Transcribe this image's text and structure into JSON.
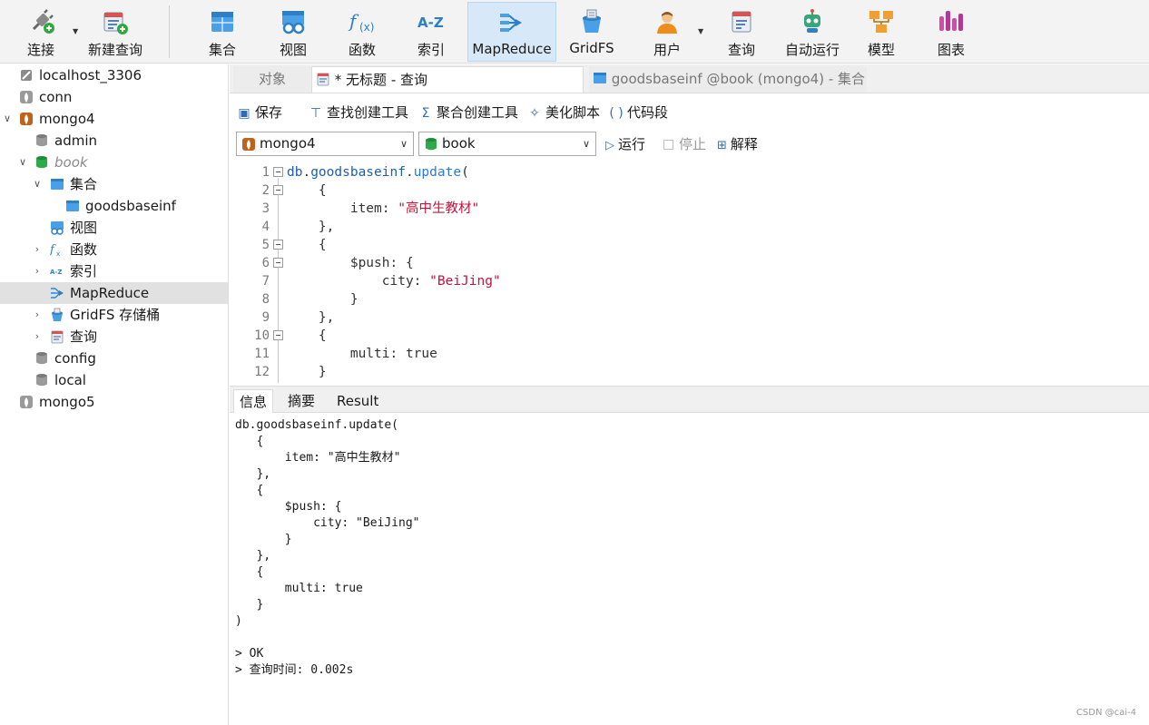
{
  "toolbar": {
    "connect": "连接",
    "new_query": "新建查询",
    "collection": "集合",
    "view": "视图",
    "function": "函数",
    "index": "索引",
    "mapreduce": "MapReduce",
    "gridfs": "GridFS",
    "user": "用户",
    "query": "查询",
    "auto_run": "自动运行",
    "model": "模型",
    "chart": "图表"
  },
  "sidebar": {
    "items": [
      {
        "label": "localhost_3306"
      },
      {
        "label": "conn"
      },
      {
        "label": "mongo4"
      },
      {
        "label": "admin"
      },
      {
        "label": "book"
      },
      {
        "label": "集合"
      },
      {
        "label": "goodsbaseinf"
      },
      {
        "label": "视图"
      },
      {
        "label": "函数"
      },
      {
        "label": "索引"
      },
      {
        "label": "MapReduce"
      },
      {
        "label": "GridFS 存储桶"
      },
      {
        "label": "查询"
      },
      {
        "label": "config"
      },
      {
        "label": "local"
      },
      {
        "label": "mongo5"
      }
    ]
  },
  "tabs": {
    "objects": "对象",
    "untitled": "* 无标题 - 查询",
    "collection_tab": "goodsbaseinf @book (mongo4) - 集合"
  },
  "editor_toolbar": {
    "save": "保存",
    "find_builder": "查找创建工具",
    "aggregate_builder": "聚合创建工具",
    "beautify": "美化脚本",
    "snippet": "代码段"
  },
  "selectors": {
    "connection": "mongo4",
    "database": "book",
    "run": "运行",
    "stop": "停止",
    "explain": "解释"
  },
  "code": {
    "line_numbers": [
      "1",
      "2",
      "3",
      "4",
      "5",
      "6",
      "7",
      "8",
      "9",
      "10",
      "11",
      "12"
    ],
    "l1_obj": "db",
    "l1_dot1": ".",
    "l1_coll": "goodsbaseinf",
    "l1_dot2": ".",
    "l1_fn": "update",
    "l1_paren": "(",
    "l2": "    {",
    "l3_key": "        item: ",
    "l3_val": "\"高中生教材\"",
    "l4": "    },",
    "l5": "    {",
    "l6": "        $push: {",
    "l7_key": "            city: ",
    "l7_val": "\"BeiJing\"",
    "l8": "        }",
    "l9": "    },",
    "l10": "    {",
    "l11": "        multi: true",
    "l12": "    }"
  },
  "result_tabs": {
    "info": "信息",
    "summary": "摘要",
    "result": "Result"
  },
  "output": {
    "lines": [
      "db.goodsbaseinf.update(",
      "   {",
      "       item: \"高中生教材\"",
      "   },",
      "   {",
      "       $push: {",
      "           city: \"BeiJing\"",
      "       }",
      "   },",
      "   {",
      "       multi: true",
      "   }",
      ")",
      "",
      "> OK",
      "> 查询时间: 0.002s"
    ]
  },
  "watermark": "CSDN @cai-4"
}
